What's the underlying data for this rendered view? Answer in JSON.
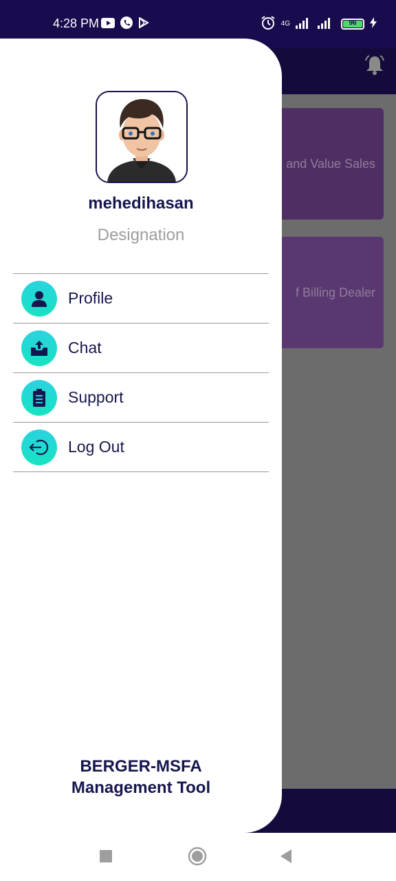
{
  "status_bar": {
    "time": "4:28 PM",
    "network": "4G",
    "battery": "96",
    "icons": [
      "youtube-icon",
      "phone-icon",
      "play-store-icon",
      "alarm-icon",
      "signal-icon",
      "battery-icon",
      "charging-icon"
    ]
  },
  "background": {
    "cards": [
      {
        "text": "and Value Sales"
      },
      {
        "text": "f Billing Dealer"
      }
    ]
  },
  "drawer": {
    "user": {
      "name": "mehedihasan",
      "designation": "Designation"
    },
    "menu": [
      {
        "label": "Profile",
        "icon": "person-icon"
      },
      {
        "label": "Chat",
        "icon": "upload-tray-icon"
      },
      {
        "label": "Support",
        "icon": "clipboard-icon"
      },
      {
        "label": "Log Out",
        "icon": "logout-icon"
      }
    ],
    "brand": {
      "line1": "BERGER-MSFA",
      "line2": "Management Tool"
    }
  },
  "colors": {
    "accent": "#1ee0cc",
    "navy": "#16164e",
    "status_bar": "#1a0a4e"
  }
}
